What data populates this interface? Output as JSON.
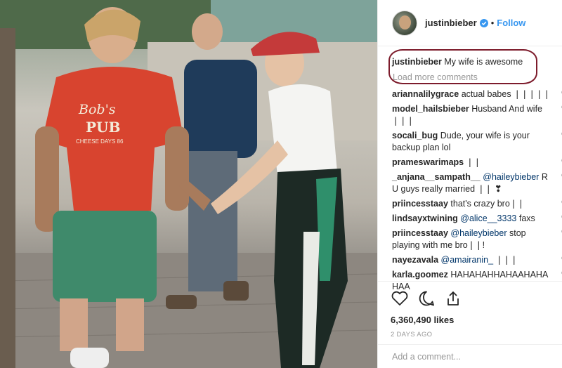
{
  "photo": {
    "shirt_text": [
      "Bob's",
      "PUB",
      "CHEESE DAYS 86"
    ]
  },
  "header": {
    "username": "justinbieber",
    "separator": "•",
    "follow_label": "Follow"
  },
  "caption": {
    "username": "justinbieber",
    "text": "My wife is awesome",
    "load_more": "Load more comments"
  },
  "comments": [
    {
      "user": "ariannalilygrace",
      "text": "actual babes ❘❘❘❘❘",
      "line2": ""
    },
    {
      "user": "model_hailsbieber",
      "text": "Husband And wife",
      "line2": "❘❘❘"
    },
    {
      "user": "socali_bug",
      "text": "Dude, your wife is your",
      "line2": "backup plan lol"
    },
    {
      "user": "prameswarimaps",
      "text": "❘❘",
      "line2": ""
    },
    {
      "user": "_anjana__sampath__",
      "mention": "@haileybieber",
      "text": "R",
      "line2": "U guys really married ❘❘ ❣"
    },
    {
      "user": "priincesstaay",
      "text": "that's crazy bro❘❘",
      "line2": ""
    },
    {
      "user": "lindsayxtwining",
      "mention": "@alice__3333",
      "text": "faxs",
      "line2": ""
    },
    {
      "user": "priincesstaay",
      "mention": "@haileybieber",
      "text": "stop",
      "line2": "playing with me bro❘❘!"
    },
    {
      "user": "nayezavala",
      "mention": "@amairanin_",
      "text": "❘❘❘",
      "line2": ""
    },
    {
      "user": "karla.goomez",
      "text": "HAHAHAHHAHAAHAHA",
      "line2": "HAA"
    }
  ],
  "actions": {
    "likes": "6,360,490 likes",
    "posted": "2 DAYS AGO"
  },
  "add_comment": {
    "placeholder": "Add a comment..."
  },
  "colors": {
    "accent": "#3897f0",
    "highlight_border": "#7d1c2c",
    "text": "#262626",
    "muted": "#999999"
  },
  "icons": [
    "verified-icon",
    "heart-icon",
    "comment-icon",
    "share-icon"
  ]
}
